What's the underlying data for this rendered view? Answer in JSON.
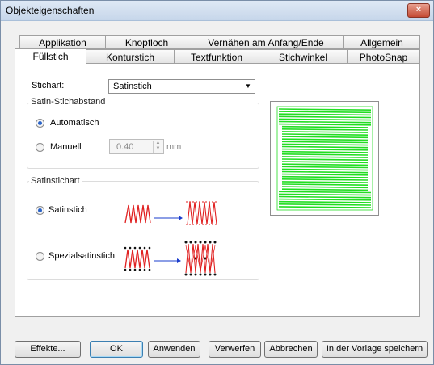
{
  "window": {
    "title": "Objekteigenschaften",
    "close_glyph": "×"
  },
  "tabs_back": [
    "Applikation",
    "Knopfloch",
    "Vernähen am Anfang/Ende",
    "Allgemein"
  ],
  "tabs_front": [
    "Füllstich",
    "Konturstich",
    "Textfunktion",
    "Stichwinkel",
    "PhotoSnap"
  ],
  "active_tab": "Füllstich",
  "stitch_type": {
    "label": "Stichart:",
    "value": "Satinstich"
  },
  "spacing_group": {
    "label": "Satin-Stichabstand",
    "auto_label": "Automatisch",
    "manual_label": "Manuell",
    "selected": "Automatisch",
    "value": "0.40",
    "unit": "mm"
  },
  "satin_group": {
    "label": "Satinstichart",
    "option1_label": "Satinstich",
    "option2_label": "Spezialsatinstich",
    "selected": "Satinstich"
  },
  "colors": {
    "accent": "#2a63c8",
    "stitch_red": "#e02020",
    "preview_green": "#22dd22",
    "arrow_blue": "#1a3ccc"
  },
  "buttons": {
    "effects": "Effekte...",
    "ok": "OK",
    "apply": "Anwenden",
    "discard": "Verwerfen",
    "cancel": "Abbrechen",
    "save_template": "In der Vorlage speichern"
  }
}
